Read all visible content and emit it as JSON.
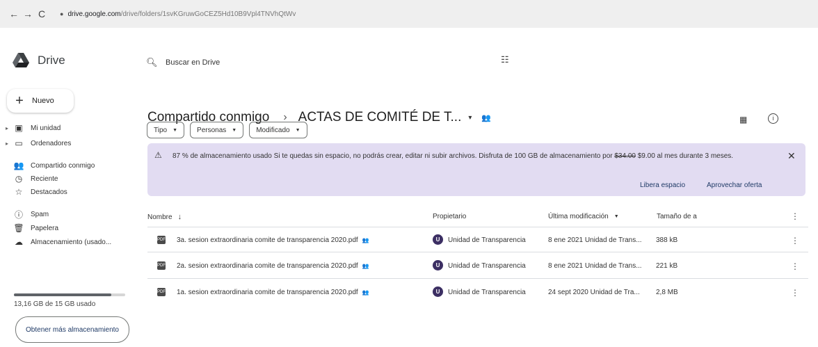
{
  "browser": {
    "back_icon": "←",
    "forward_icon": "→",
    "reload_icon": "C",
    "url_host": "drive.google.com",
    "url_path": "/drive/folders/1svKGruwGoCEZ5Hd10B9Vpl4TNVhQtWv"
  },
  "sidebar": {
    "logo_text": "Drive",
    "new_label": "Nuevo",
    "items": [
      {
        "label": "Mi unidad",
        "icon": "drive-icon",
        "glyph": "▣",
        "caret": true
      },
      {
        "label": "Ordenadores",
        "icon": "computer-icon",
        "glyph": "▭",
        "caret": true
      },
      {
        "label": "Compartido conmigo",
        "icon": "people-icon",
        "glyph": "👥",
        "caret": false
      },
      {
        "label": "Reciente",
        "icon": "clock-icon",
        "glyph": "◷",
        "caret": false
      },
      {
        "label": "Destacados",
        "icon": "star-icon",
        "glyph": "☆",
        "caret": false
      },
      {
        "label": "Spam",
        "icon": "spam-icon",
        "glyph": "ⓘ",
        "caret": false
      },
      {
        "label": "Papelera",
        "icon": "trash-icon",
        "glyph": "🗑",
        "caret": false
      },
      {
        "label": "Almacenamiento (usado...",
        "icon": "cloud-icon",
        "glyph": "☁",
        "caret": false
      }
    ],
    "storage_used_fraction": 0.877,
    "storage_text": "13,16 GB de 15 GB usado",
    "more_storage_label": "Obtener más almacenamiento"
  },
  "search": {
    "placeholder": "Buscar en Drive"
  },
  "header": {
    "crumb_root": "Compartido conmigo",
    "crumb_sep": "›",
    "crumb_current": "ACTAS DE COMITÉ DE T...",
    "crumb_caret": "▾"
  },
  "filters": [
    {
      "label": "Tipo"
    },
    {
      "label": "Personas"
    },
    {
      "label": "Modificado"
    }
  ],
  "banner": {
    "text_main": "87 % de almacenamiento usado Si te quedas sin espacio, no podrás crear, editar ni subir archivos. Disfruta de 100 GB de almacenamiento por ",
    "old_price": "$34.00",
    "text_end": " $9.00 al mes durante 3 meses.",
    "action_free": "Libera espacio",
    "action_offer": "Aprovechar oferta"
  },
  "table": {
    "col_name": "Nombre",
    "col_owner": "Propietario",
    "col_modified": "Última modificación",
    "col_size": "Tamaño de a",
    "rows": [
      {
        "name": "3a. sesion extraordinaria comite de transparencia 2020.pdf",
        "owner": "Unidad de Transparencia",
        "owner_initial": "U",
        "modified": "8 ene 2021 Unidad de Trans...",
        "size": "388 kB"
      },
      {
        "name": "2a. sesion extraordinaria comite de transparencia 2020.pdf",
        "owner": "Unidad de Transparencia",
        "owner_initial": "U",
        "modified": "8 ene 2021 Unidad de Trans...",
        "size": "221 kB"
      },
      {
        "name": "1a. sesion extraordinaria comite de transparencia 2020.pdf",
        "owner": "Unidad de Transparencia",
        "owner_initial": "U",
        "modified": "24 sept 2020 Unidad de Tra...",
        "size": "2,8 MB"
      }
    ]
  }
}
